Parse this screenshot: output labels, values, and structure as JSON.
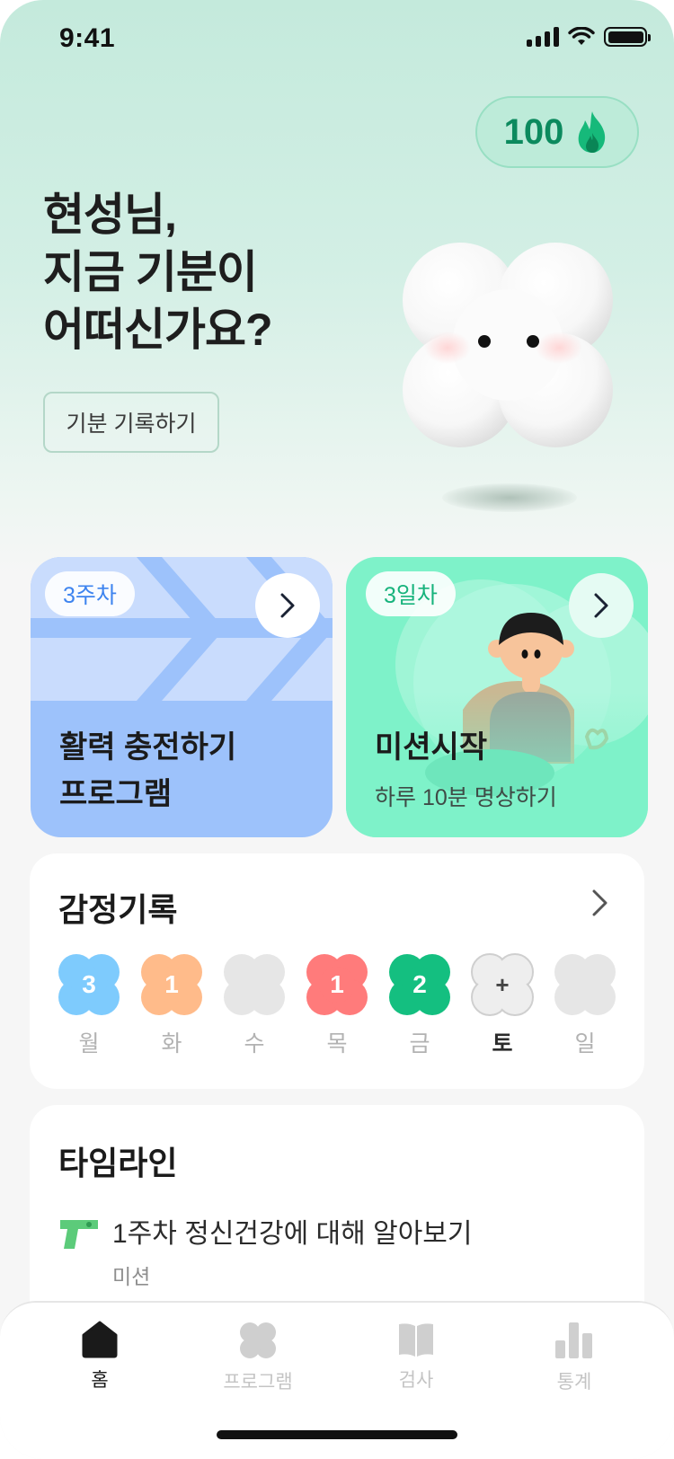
{
  "status": {
    "time": "9:41"
  },
  "streak": {
    "count": "100",
    "icon": "flame-icon"
  },
  "greeting": {
    "line1": "현성님,",
    "line2": "지금 기분이",
    "line3": "어떠신가요?"
  },
  "mood_button": {
    "label": "기분 기록하기"
  },
  "program_card": {
    "badge": "3주차",
    "title_line1": "활력 충전하기",
    "title_line2": "프로그램",
    "color": "#9dc2fb"
  },
  "mission_card": {
    "badge": "3일차",
    "title": "미션시작",
    "subtitle": "하루 10분 명상하기",
    "color": "#7ef2c9"
  },
  "emotion_record": {
    "title": "감정기록",
    "days": [
      {
        "label": "월",
        "count": "3",
        "color": "#7ecbfd"
      },
      {
        "label": "화",
        "count": "1",
        "color": "#ffbb8a"
      },
      {
        "label": "수",
        "count": "",
        "color": "#e6e6e6"
      },
      {
        "label": "목",
        "count": "1",
        "color": "#ff7b7b"
      },
      {
        "label": "금",
        "count": "2",
        "color": "#14bf80"
      },
      {
        "label": "토",
        "count": "+",
        "color": "#eeeeee"
      },
      {
        "label": "일",
        "count": "",
        "color": "#e6e6e6"
      }
    ]
  },
  "timeline": {
    "title": "타임라인",
    "items": [
      {
        "title": "1주차 정신건강에 대해 알아보기",
        "subtitle": "미션",
        "icon": "pistol-icon"
      }
    ]
  },
  "tabs": [
    {
      "label": "홈",
      "icon": "home-icon",
      "active": true
    },
    {
      "label": "프로그램",
      "icon": "flower-icon",
      "active": false
    },
    {
      "label": "검사",
      "icon": "book-icon",
      "active": false
    },
    {
      "label": "통계",
      "icon": "bar-chart-icon",
      "active": false
    }
  ]
}
